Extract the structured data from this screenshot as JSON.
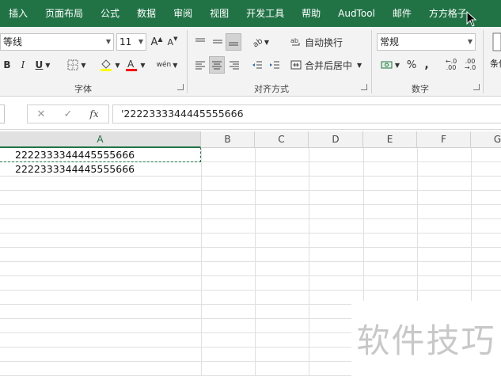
{
  "menu": {
    "items": [
      "插入",
      "页面布局",
      "公式",
      "数据",
      "审阅",
      "视图",
      "开发工具",
      "帮助",
      "AudTool",
      "邮件",
      "方方格子"
    ]
  },
  "ribbon": {
    "font_group": {
      "label": "字体",
      "font_name": "等线",
      "font_size": "11",
      "bold": "B",
      "italic": "I",
      "underline": "U",
      "grow_font": "A",
      "shrink_font": "A",
      "phonetic": "wén"
    },
    "align_group": {
      "label": "对齐方式",
      "wrap_text": "自动换行",
      "merge_center": "合并后居中"
    },
    "number_group": {
      "label": "数字",
      "format": "常规",
      "percent": "%",
      "comma": ",",
      "inc_decimal": "←.0\n.00",
      "dec_decimal": ".00\n→.0"
    },
    "styles_group": {
      "partial_label": "条件"
    }
  },
  "formula_bar": {
    "cancel": "✕",
    "enter": "✓",
    "fx": "fx",
    "value": "'2222333344445555666"
  },
  "grid": {
    "columns": [
      "A",
      "B",
      "C",
      "D",
      "E",
      "F",
      "G"
    ],
    "active_column": "A",
    "cells": {
      "A1": "2222333344445555666",
      "A2": "2222333344445555666"
    }
  },
  "watermark": "软件技巧",
  "colors": {
    "accent": "#217346",
    "fill_highlight": "#ffff00",
    "font_color": "#ff0000"
  }
}
